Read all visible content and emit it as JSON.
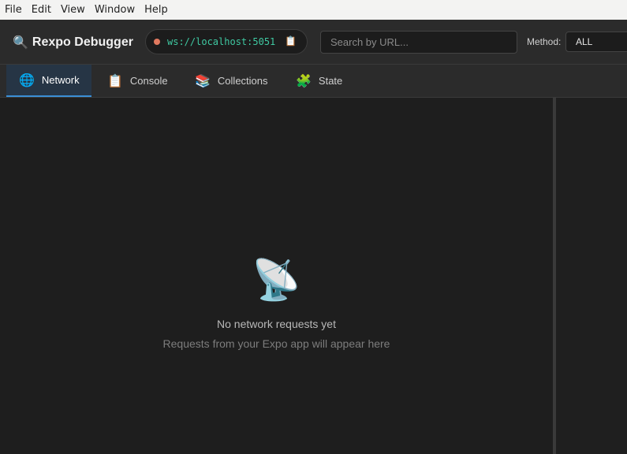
{
  "menubar": {
    "items": [
      "File",
      "Edit",
      "View",
      "Window",
      "Help"
    ]
  },
  "toolbar": {
    "brand_icon": "🔍",
    "title": "Rexpo Debugger",
    "connection": {
      "status_color": "#e0795f",
      "url": "ws://localhost:5051",
      "copy_icon": "📋"
    },
    "search": {
      "placeholder": "Search by URL...",
      "value": ""
    },
    "method_filter": {
      "label": "Method:",
      "selected": "ALL"
    }
  },
  "tabs": [
    {
      "icon": "🌐",
      "label": "Network",
      "active": true
    },
    {
      "icon": "📋",
      "label": "Console",
      "active": false
    },
    {
      "icon": "📚",
      "label": "Collections",
      "active": false
    },
    {
      "icon": "🧩",
      "label": "State",
      "active": false
    }
  ],
  "empty_state": {
    "icon": "📡",
    "title": "No network requests yet",
    "subtitle": "Requests from your Expo app will appear here"
  },
  "colors": {
    "accent": "#3a8fd6",
    "background": "#1e1e1e",
    "toolbar": "#2b2b2b",
    "connection_text": "#3fc9a2"
  }
}
